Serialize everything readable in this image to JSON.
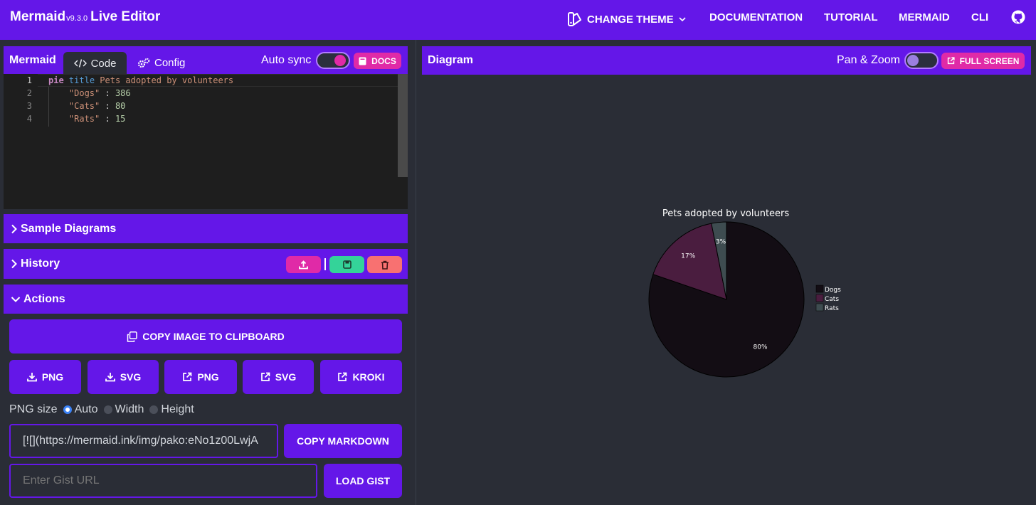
{
  "header": {
    "brand": "Mermaid",
    "version": "v9.3.0",
    "subtitle": "Live Editor",
    "nav": [
      "CHANGE THEME",
      "DOCUMENTATION",
      "TUTORIAL",
      "MERMAID",
      "CLI"
    ]
  },
  "editor_panel": {
    "title": "Mermaid",
    "tabs": [
      "Code",
      "Config"
    ],
    "active_tab": "Code",
    "auto_sync_label": "Auto sync",
    "auto_sync_on": true,
    "docs_label": "DOCS",
    "lines": [
      {
        "n": "1",
        "parts": [
          {
            "t": "pie",
            "c": "kw"
          },
          {
            "t": " ",
            "c": ""
          },
          {
            "t": "title",
            "c": "kw2"
          },
          {
            "t": " Pets adopted by volunteers",
            "c": "str"
          }
        ]
      },
      {
        "n": "2",
        "parts": [
          {
            "t": "    ",
            "c": ""
          },
          {
            "t": "\"Dogs\"",
            "c": "str"
          },
          {
            "t": " : ",
            "c": ""
          },
          {
            "t": "386",
            "c": "num"
          }
        ]
      },
      {
        "n": "3",
        "parts": [
          {
            "t": "    ",
            "c": ""
          },
          {
            "t": "\"Cats\"",
            "c": "str"
          },
          {
            "t": " : ",
            "c": ""
          },
          {
            "t": "80",
            "c": "num"
          }
        ]
      },
      {
        "n": "4",
        "parts": [
          {
            "t": "    ",
            "c": ""
          },
          {
            "t": "\"Rats\"",
            "c": "str"
          },
          {
            "t": " : ",
            "c": ""
          },
          {
            "t": "15",
            "c": "num"
          }
        ]
      }
    ]
  },
  "sample_diagrams": {
    "label": "Sample Diagrams"
  },
  "history": {
    "label": "History"
  },
  "actions": {
    "label": "Actions",
    "copy_image": "COPY IMAGE TO CLIPBOARD",
    "buttons": [
      "PNG",
      "SVG",
      "PNG",
      "SVG",
      "KROKI"
    ],
    "png_size_label": "PNG size",
    "png_size_options": [
      "Auto",
      "Width",
      "Height"
    ],
    "png_size_selected": "Auto",
    "markdown_value": "[![](https://mermaid.ink/img/pako:eNo1z00LwjA",
    "copy_markdown": "COPY MARKDOWN",
    "gist_placeholder": "Enter Gist URL",
    "load_gist": "LOAD GIST"
  },
  "diagram_panel": {
    "title": "Diagram",
    "pan_zoom_label": "Pan & Zoom",
    "pan_zoom_on": false,
    "full_screen_label": "FULL SCREEN"
  },
  "colors": {
    "accent": "#6417e8",
    "pink": "#e02aa7",
    "green": "#34d399",
    "coral": "#f87171",
    "background": "#2a2d36",
    "editor_bg": "#1e1e1e"
  },
  "chart_data": {
    "type": "pie",
    "title": "Pets adopted by volunteers",
    "labels": [
      "Dogs",
      "Cats",
      "Rats"
    ],
    "values": [
      386,
      80,
      15
    ],
    "percent_labels": [
      "80%",
      "17%",
      "3%"
    ],
    "colors": [
      "#130d14",
      "#4a1d3f",
      "#3e4c50"
    ],
    "legend": "right"
  }
}
